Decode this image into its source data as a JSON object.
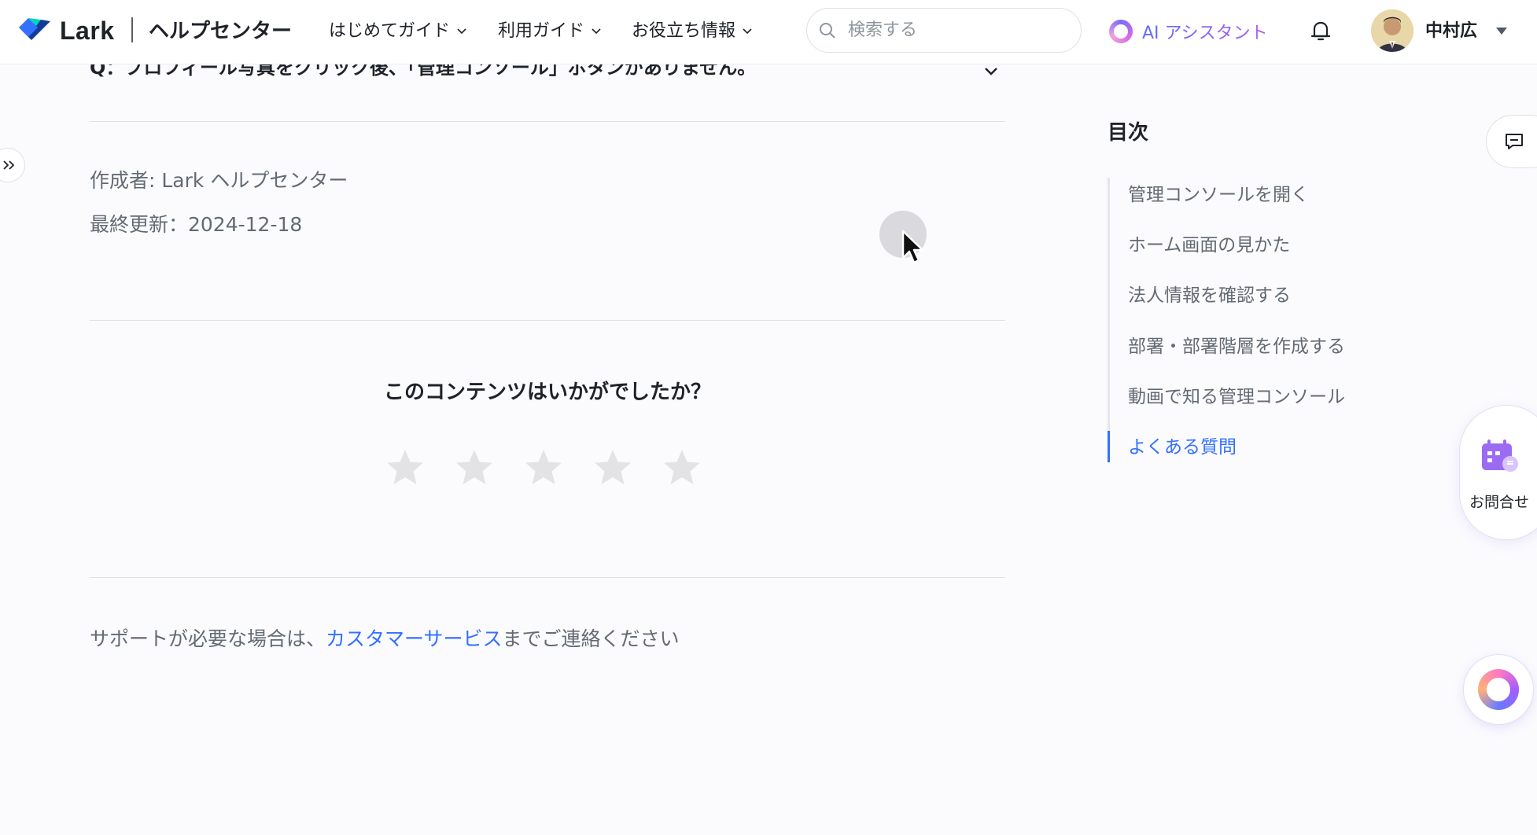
{
  "header": {
    "logo_text": "Lark",
    "site_title": "ヘルプセンター",
    "nav": [
      {
        "label": "はじめてガイド"
      },
      {
        "label": "利用ガイド"
      },
      {
        "label": "お役立ち情報"
      }
    ],
    "search_placeholder": "検索する",
    "ai_assistant_label": "AI アシスタント",
    "user_name": "中村広"
  },
  "article": {
    "faq_question": "Q：プロフィール写真をクリック後、「管理コンソール」ボタンがありません。",
    "author": "作成者: Lark ヘルプセンター",
    "last_updated": "最終更新：2024-12-18"
  },
  "rating": {
    "question": "このコンテンツはいかがでしたか？",
    "stars": 5,
    "selected": 0
  },
  "support": {
    "prefix": "サポートが必要な場合は、",
    "link_text": "カスタマーサービス",
    "suffix": "までご連絡ください"
  },
  "toc": {
    "title": "目次",
    "items": [
      {
        "label": "管理コンソールを開く",
        "active": false
      },
      {
        "label": "ホーム画面の見かた",
        "active": false
      },
      {
        "label": "法人情報を確認する",
        "active": false
      },
      {
        "label": "部署・部署階層を作成する",
        "active": false
      },
      {
        "label": "動画で知る管理コンソール",
        "active": false
      },
      {
        "label": "よくある質問",
        "active": true
      }
    ]
  },
  "widgets": {
    "contact_label": "お問合せ"
  },
  "colors": {
    "accent": "#3370ff",
    "text_primary": "#1f2329",
    "text_secondary": "#646a73",
    "star": "#e3e3e6"
  },
  "icons": [
    "lark-logo-icon",
    "chevron-down-icon",
    "search-icon",
    "ai-assistant-icon",
    "bell-icon",
    "avatar",
    "double-chevron-right-icon",
    "star-icon",
    "feedback-icon",
    "contact-calendar-icon",
    "ai-float-icon",
    "mouse-pointer-icon"
  ]
}
